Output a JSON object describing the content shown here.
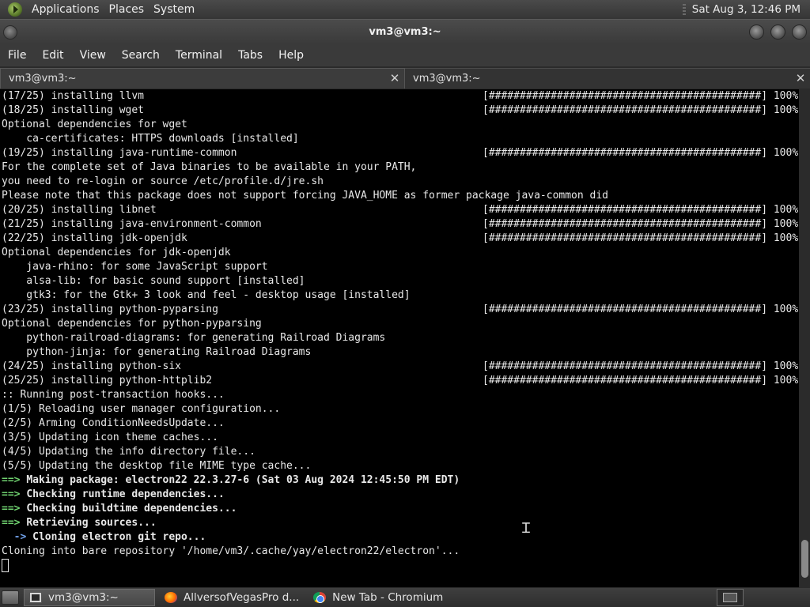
{
  "top_panel": {
    "menus": [
      "Applications",
      "Places",
      "System"
    ],
    "clock": "Sat Aug  3, 12:46 PM"
  },
  "window": {
    "title": "vm3@vm3:~"
  },
  "menubar": [
    "File",
    "Edit",
    "View",
    "Search",
    "Terminal",
    "Tabs",
    "Help"
  ],
  "tabs": [
    {
      "label": "vm3@vm3:~",
      "active": true
    },
    {
      "label": "vm3@vm3:~",
      "active": false
    }
  ],
  "terminal": {
    "progress_bar": "[############################################] 100%",
    "lines": [
      {
        "text": "(17/25) installing llvm",
        "bar": true
      },
      {
        "text": "(18/25) installing wget",
        "bar": true
      },
      {
        "text": "Optional dependencies for wget"
      },
      {
        "text": "    ca-certificates: HTTPS downloads [installed]"
      },
      {
        "text": "(19/25) installing java-runtime-common",
        "bar": true
      },
      {
        "text": "For the complete set of Java binaries to be available in your PATH,"
      },
      {
        "text": "you need to re-login or source /etc/profile.d/jre.sh"
      },
      {
        "text": "Please note that this package does not support forcing JAVA_HOME as former package java-common did"
      },
      {
        "text": "(20/25) installing libnet",
        "bar": true
      },
      {
        "text": "(21/25) installing java-environment-common",
        "bar": true
      },
      {
        "text": "(22/25) installing jdk-openjdk",
        "bar": true
      },
      {
        "text": "Optional dependencies for jdk-openjdk"
      },
      {
        "text": "    java-rhino: for some JavaScript support"
      },
      {
        "text": "    alsa-lib: for basic sound support [installed]"
      },
      {
        "text": "    gtk3: for the Gtk+ 3 look and feel - desktop usage [installed]"
      },
      {
        "text": "(23/25) installing python-pyparsing",
        "bar": true
      },
      {
        "text": "Optional dependencies for python-pyparsing"
      },
      {
        "text": "    python-railroad-diagrams: for generating Railroad Diagrams"
      },
      {
        "text": "    python-jinja: for generating Railroad Diagrams"
      },
      {
        "text": "(24/25) installing python-six",
        "bar": true
      },
      {
        "text": "(25/25) installing python-httplib2",
        "bar": true
      },
      {
        "text": ":: Running post-transaction hooks..."
      },
      {
        "text": "(1/5) Reloading user manager configuration..."
      },
      {
        "text": "(2/5) Arming ConditionNeedsUpdate..."
      },
      {
        "text": "(3/5) Updating icon theme caches..."
      },
      {
        "text": "(4/5) Updating the info directory file..."
      },
      {
        "text": "(5/5) Updating the desktop file MIME type cache..."
      },
      {
        "prefix": "==> ",
        "prefix_style": "green",
        "text": "Making package: electron22 22.3.27-6 (Sat 03 Aug 2024 12:45:50 PM EDT)",
        "bold": true
      },
      {
        "prefix": "==> ",
        "prefix_style": "green",
        "text": "Checking runtime dependencies...",
        "bold": true
      },
      {
        "prefix": "==> ",
        "prefix_style": "green",
        "text": "Checking buildtime dependencies...",
        "bold": true
      },
      {
        "prefix": "==> ",
        "prefix_style": "green",
        "text": "Retrieving sources...",
        "bold": true
      },
      {
        "prefix": "  -> ",
        "prefix_style": "blue",
        "text": "Cloning electron git repo...",
        "bold": true
      },
      {
        "text": "Cloning into bare repository '/home/vm3/.cache/yay/electron22/electron'..."
      }
    ]
  },
  "taskbar": {
    "tasks": [
      {
        "label": "vm3@vm3:~",
        "icon": "terminal-icon",
        "active": true
      },
      {
        "label": "AllversofVegasPro d...",
        "icon": "firefox-icon",
        "active": false
      },
      {
        "label": "New Tab - Chromium",
        "icon": "chromium-icon",
        "active": false
      }
    ]
  }
}
